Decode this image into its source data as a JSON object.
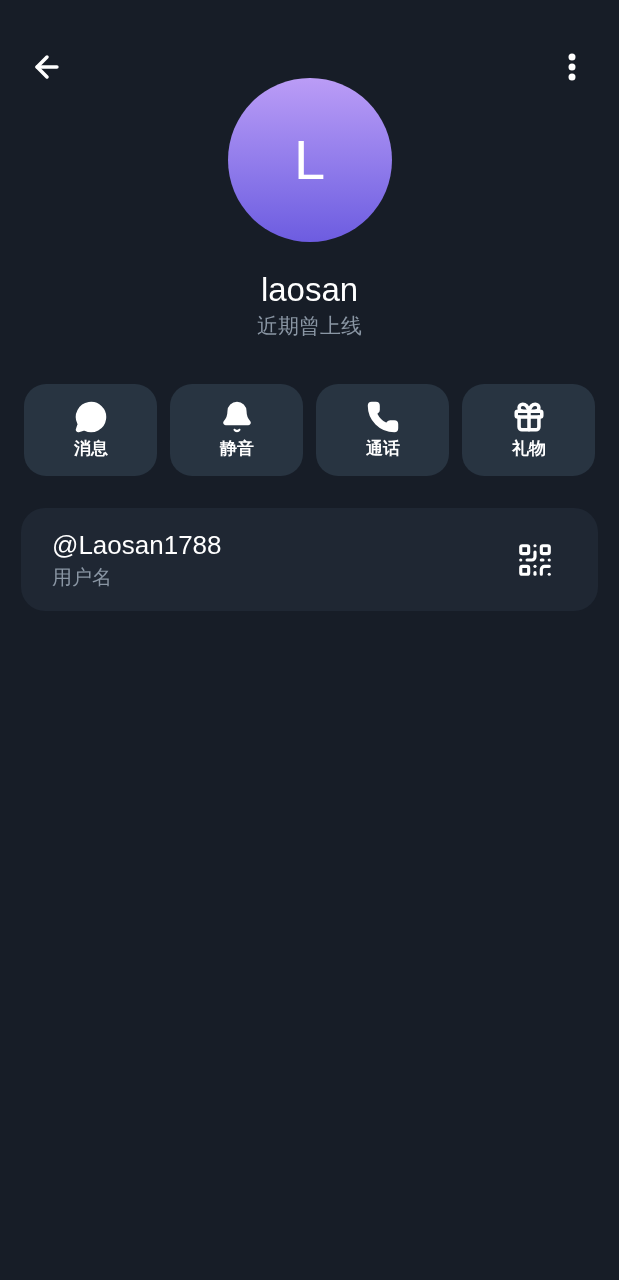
{
  "profile": {
    "avatar_letter": "L",
    "name": "laosan",
    "status": "近期曾上线"
  },
  "actions": [
    {
      "label": "消息",
      "kind": "message"
    },
    {
      "label": "静音",
      "kind": "mute"
    },
    {
      "label": "通话",
      "kind": "call"
    },
    {
      "label": "礼物",
      "kind": "gift"
    }
  ],
  "username_card": {
    "value": "@Laosan1788",
    "label": "用户名"
  }
}
